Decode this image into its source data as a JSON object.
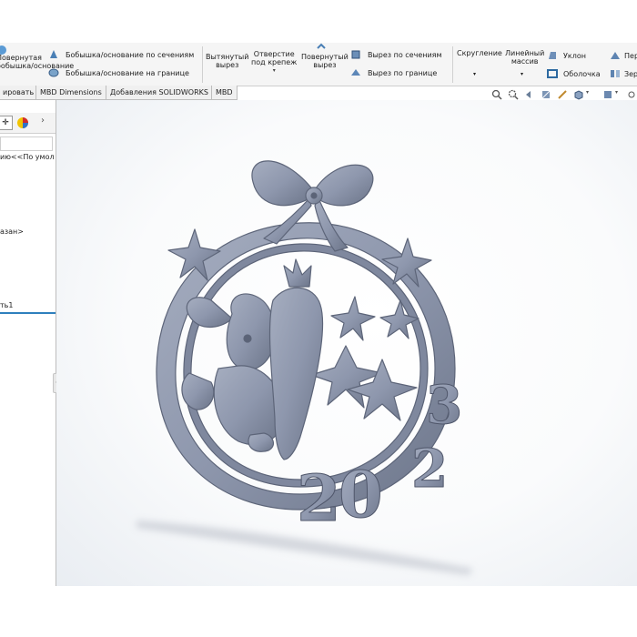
{
  "ribbon": {
    "revolved_boss": "Повернутая\nбобышка/основание",
    "loft_boss": "Бобышка/основание по сечениям",
    "boundary_boss": "Бобышка/основание на границе",
    "extruded_cut": "Вытянутый\nвырез",
    "hole_wizard": "Отверстие\nпод крепеж",
    "revolved_cut": "Повернутый\nвырез",
    "lofted_cut": "Вырез по сечениям",
    "boundary_cut": "Вырез по границе",
    "fillet": "Скругление",
    "linear_pattern": "Линейный\nмассив",
    "draft": "Уклон",
    "shell": "Оболочка",
    "rib": "Пер",
    "mirror": "Зер"
  },
  "tabs": [
    {
      "label": "ировать"
    },
    {
      "label": "MBD Dimensions"
    },
    {
      "label": "Добавления SOLIDWORKS"
    },
    {
      "label": "MBD"
    }
  ],
  "feature_manager": {
    "line1": "ию<<По умол",
    "line2": "азан>",
    "line3": "ть1"
  },
  "model": {
    "year_text": "2023",
    "color": "#8e97ad",
    "shadow": "#cfd4dc"
  },
  "colors": {
    "ribbon_bg": "#f5f5f5",
    "accent": "#2e7fbd"
  }
}
